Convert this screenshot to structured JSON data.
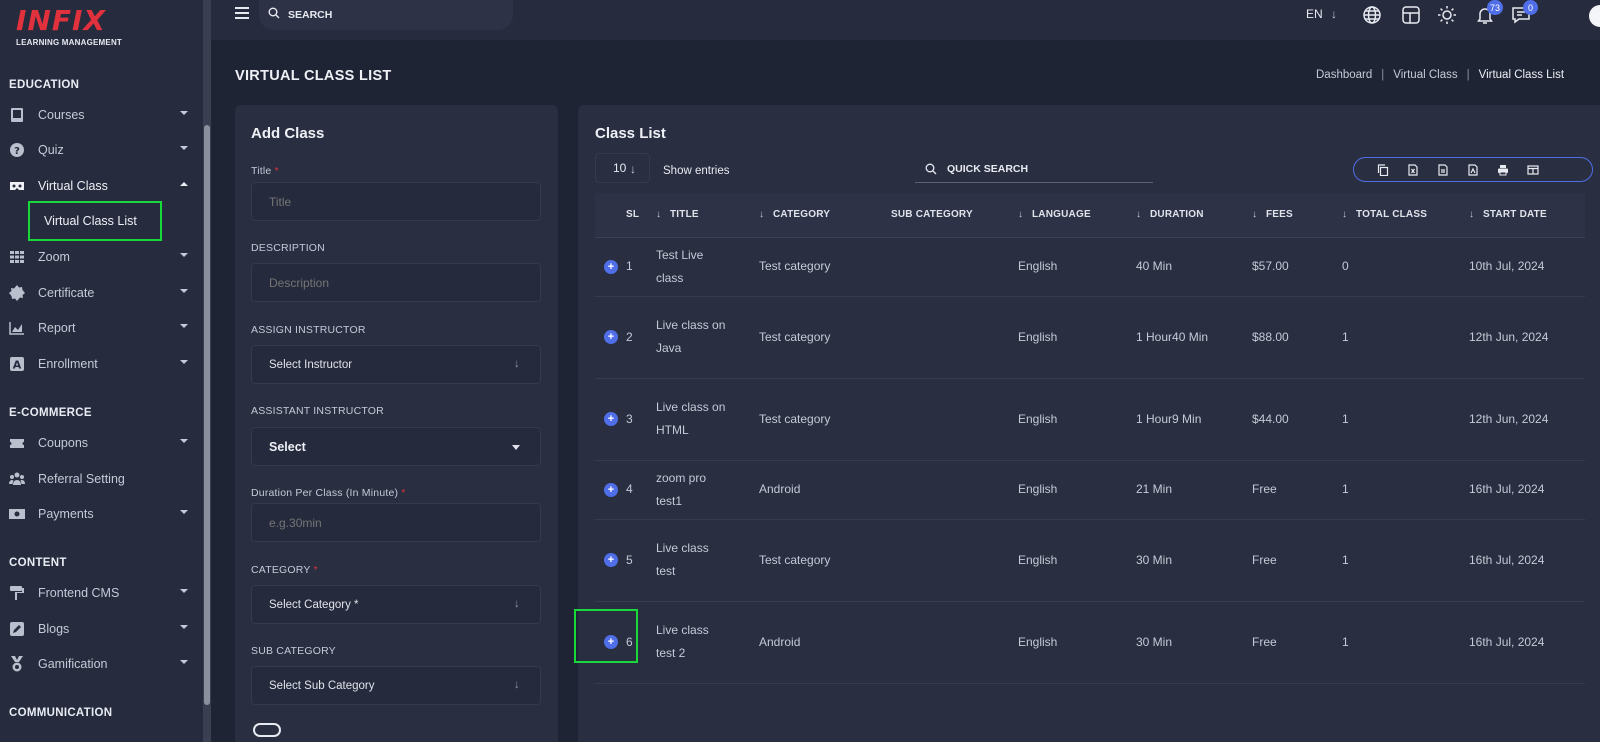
{
  "logo": {
    "main": "INFIX",
    "sub": "LEARNING MANAGEMENT"
  },
  "sidebar": {
    "sections": [
      {
        "title": "EDUCATION"
      },
      {
        "title": "E-COMMERCE"
      },
      {
        "title": "CONTENT"
      },
      {
        "title": "COMMUNICATION"
      }
    ],
    "items": [
      {
        "label": "Courses",
        "icon": "book-icon"
      },
      {
        "label": "Quiz",
        "icon": "question-icon"
      },
      {
        "label": "Virtual Class",
        "icon": "vr-icon",
        "expanded": true
      },
      {
        "label": "Zoom",
        "icon": "grid-icon"
      },
      {
        "label": "Certificate",
        "icon": "badge-icon"
      },
      {
        "label": "Report",
        "icon": "chart-icon"
      },
      {
        "label": "Enrollment",
        "icon": "enroll-icon"
      },
      {
        "label": "Coupons",
        "icon": "ticket-icon"
      },
      {
        "label": "Referral Setting",
        "icon": "users-icon"
      },
      {
        "label": "Payments",
        "icon": "money-icon"
      },
      {
        "label": "Frontend CMS",
        "icon": "paint-roller-icon"
      },
      {
        "label": "Blogs",
        "icon": "pen-icon"
      },
      {
        "label": "Gamification",
        "icon": "medal-icon"
      }
    ],
    "subitem": "Virtual Class List"
  },
  "topbar": {
    "search_placeholder": "SEARCH",
    "lang": "EN",
    "notif_count": "73",
    "msg_count": "0"
  },
  "page": {
    "title": "VIRTUAL CLASS LIST",
    "breadcrumb": [
      "Dashboard",
      "Virtual Class",
      "Virtual Class List"
    ]
  },
  "form": {
    "title": "Add Class",
    "title_label": "Title",
    "title_placeholder": "Title",
    "desc_label": "DESCRIPTION",
    "desc_placeholder": "Description",
    "instructor_label": "ASSIGN INSTRUCTOR",
    "instructor_value": "Select Instructor",
    "assistant_label": "ASSISTANT INSTRUCTOR",
    "assistant_value": "Select",
    "duration_label": "Duration Per Class (In Minute)",
    "duration_placeholder": "e.g.30min",
    "category_label": "CATEGORY",
    "category_value": "Select Category *",
    "subcategory_label": "SUB CATEGORY",
    "subcategory_value": "Select Sub Category",
    "required_mark": "*"
  },
  "list": {
    "title": "Class List",
    "entries": "10",
    "show_entries": "Show entries",
    "quick_search_placeholder": "QUICK SEARCH",
    "columns": [
      "SL",
      "TITLE",
      "CATEGORY",
      "SUB CATEGORY",
      "LANGUAGE",
      "DURATION",
      "FEES",
      "TOTAL CLASS",
      "START DATE"
    ],
    "rows": [
      {
        "sl": "1",
        "title": "Test Live class",
        "category": "Test category",
        "sub": "",
        "language": "English",
        "duration": "40 Min",
        "fees": "$57.00",
        "total": "0",
        "start": "10th Jul, 2024"
      },
      {
        "sl": "2",
        "title": "Live class on Java",
        "category": "Test category",
        "sub": "",
        "language": "English",
        "duration": "1 Hour40 Min",
        "fees": "$88.00",
        "total": "1",
        "start": "12th Jun, 2024"
      },
      {
        "sl": "3",
        "title": "Live class on HTML",
        "category": "Test category",
        "sub": "",
        "language": "English",
        "duration": "1 Hour9 Min",
        "fees": "$44.00",
        "total": "1",
        "start": "12th Jun, 2024"
      },
      {
        "sl": "4",
        "title": "zoom pro test1",
        "category": "Android",
        "sub": "",
        "language": "English",
        "duration": "21 Min",
        "fees": "Free",
        "total": "1",
        "start": "16th Jul, 2024"
      },
      {
        "sl": "5",
        "title": "Live class test",
        "category": "Test category",
        "sub": "",
        "language": "English",
        "duration": "30 Min",
        "fees": "Free",
        "total": "1",
        "start": "16th Jul, 2024"
      },
      {
        "sl": "6",
        "title": "Live class test 2",
        "category": "Android",
        "sub": "",
        "language": "English",
        "duration": "30 Min",
        "fees": "Free",
        "total": "1",
        "start": "16th Jul, 2024"
      }
    ]
  },
  "colors": {
    "accent": "#4f6ee8",
    "brand": "#e0313d",
    "highlight": "#19d93a"
  }
}
